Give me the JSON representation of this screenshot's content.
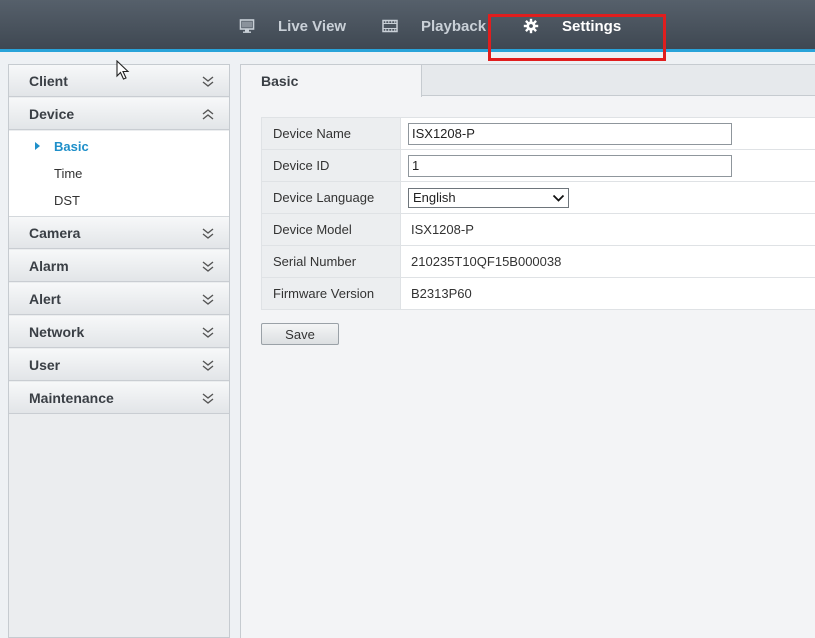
{
  "nav": {
    "live_view": "Live View",
    "playback": "Playback",
    "settings": "Settings",
    "active": "Settings",
    "accent_color": "#29a3d9",
    "highlight_color": "#e01e1e"
  },
  "sidebar": {
    "sections": [
      {
        "label": "Client",
        "expanded": false
      },
      {
        "label": "Device",
        "expanded": true
      },
      {
        "label": "Camera",
        "expanded": false
      },
      {
        "label": "Alarm",
        "expanded": false
      },
      {
        "label": "Alert",
        "expanded": false
      },
      {
        "label": "Network",
        "expanded": false
      },
      {
        "label": "User",
        "expanded": false
      },
      {
        "label": "Maintenance",
        "expanded": false
      }
    ],
    "device_items": [
      {
        "label": "Basic",
        "active": true
      },
      {
        "label": "Time",
        "active": false
      },
      {
        "label": "DST",
        "active": false
      }
    ]
  },
  "main": {
    "tab_label": "Basic",
    "fields": {
      "device_name": {
        "label": "Device Name",
        "value": "ISX1208-P"
      },
      "device_id": {
        "label": "Device ID",
        "value": "1"
      },
      "device_language": {
        "label": "Device Language",
        "value": "English"
      },
      "device_model": {
        "label": "Device Model",
        "value": "ISX1208-P"
      },
      "serial_number": {
        "label": "Serial Number",
        "value": "210235T10QF15B000038"
      },
      "firmware_version": {
        "label": "Firmware Version",
        "value": "B2313P60"
      }
    },
    "save_label": "Save"
  }
}
